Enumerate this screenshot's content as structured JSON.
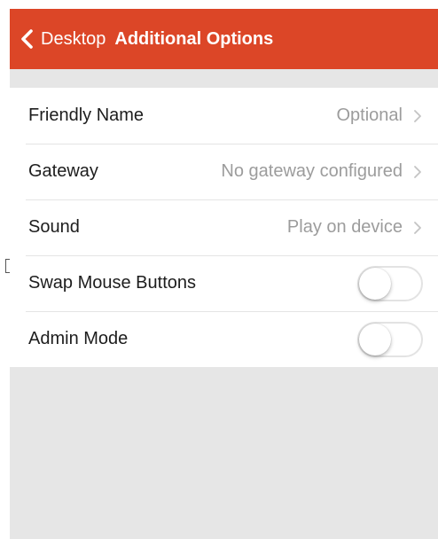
{
  "nav": {
    "back_label": "Desktop",
    "title": "Additional Options",
    "color": "#dc4627"
  },
  "settings": [
    {
      "label": "Friendly Name",
      "value": "Optional",
      "type": "disclosure"
    },
    {
      "label": "Gateway",
      "value": "No gateway configured",
      "type": "disclosure"
    },
    {
      "label": "Sound",
      "value": "Play on device",
      "type": "disclosure"
    },
    {
      "label": "Swap Mouse Buttons",
      "type": "toggle",
      "on": false
    },
    {
      "label": "Admin Mode",
      "type": "toggle",
      "on": false
    }
  ]
}
